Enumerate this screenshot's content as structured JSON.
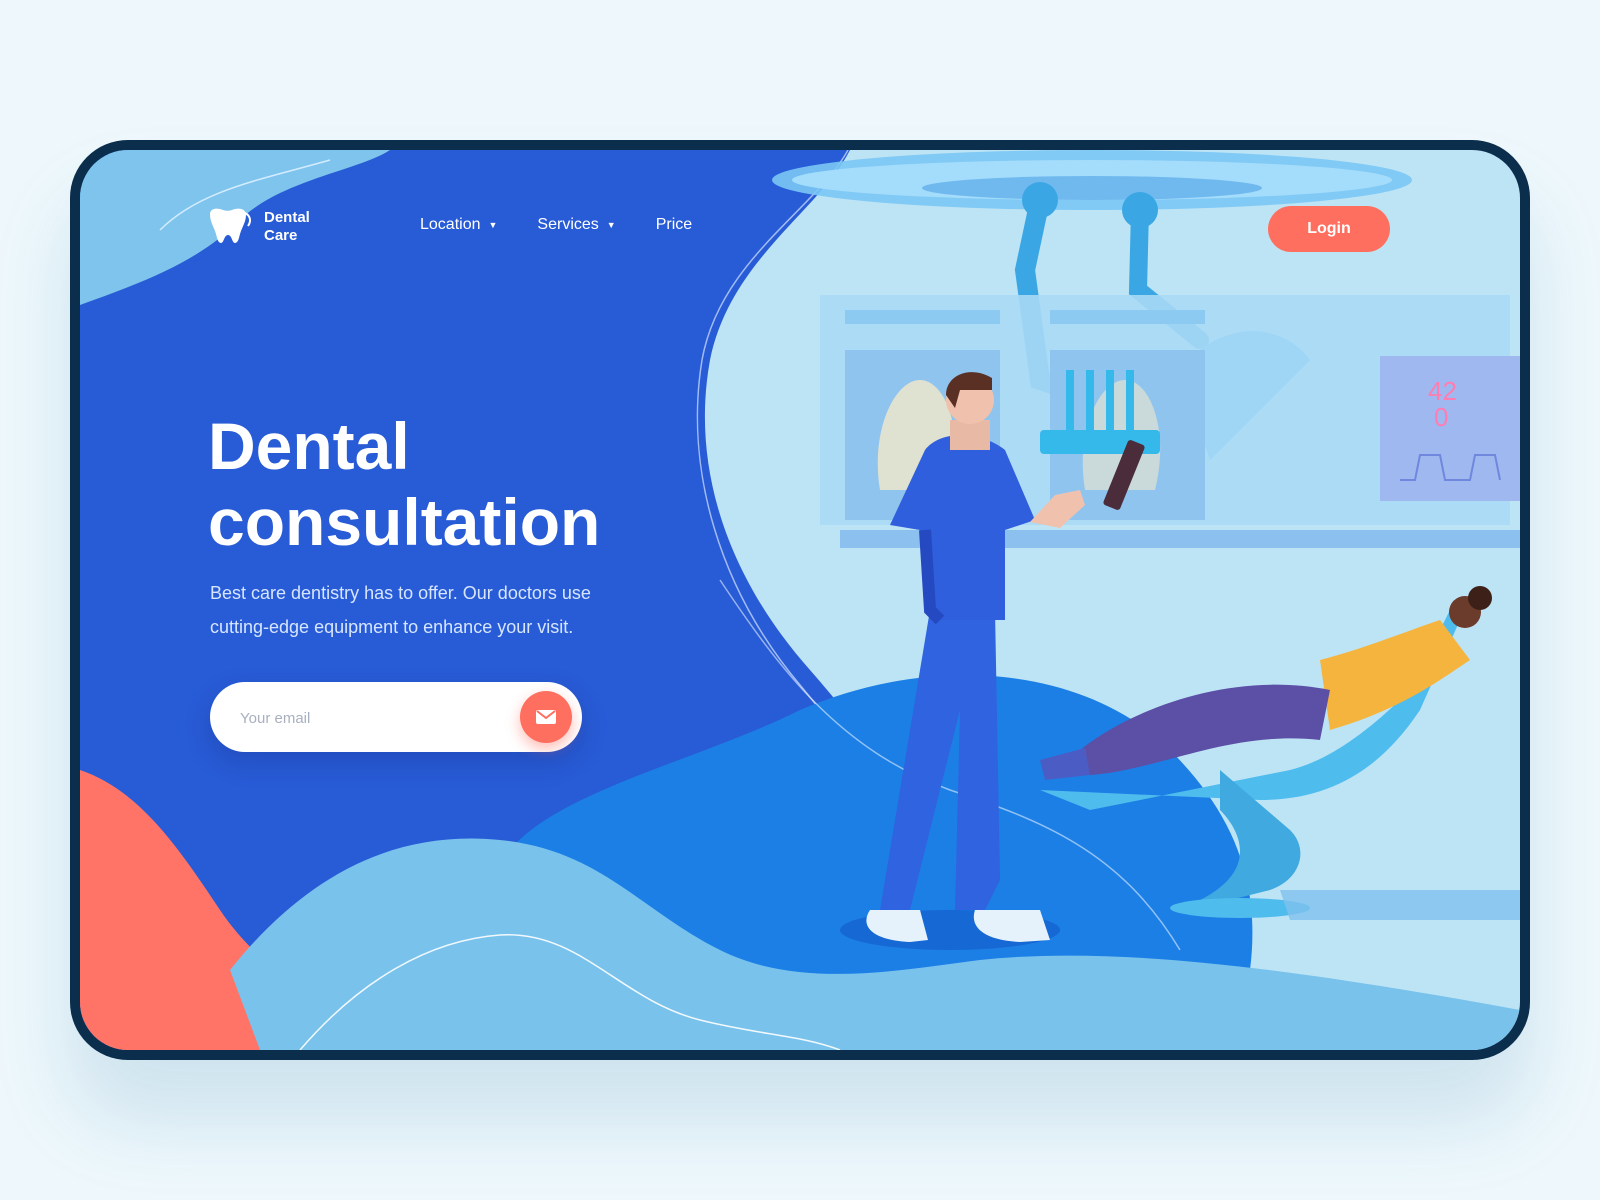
{
  "brand": {
    "line1": "Dental",
    "line2": "Care",
    "icon": "tooth-icon"
  },
  "nav": {
    "location_label": "Location",
    "services_label": "Services",
    "price_label": "Price"
  },
  "auth": {
    "login_label": "Login"
  },
  "hero": {
    "title_line1": "Dental",
    "title_line2": "consultation",
    "subtitle": "Best care dentistry has to offer. Our doctors use cutting-edge equipment to enhance your visit."
  },
  "signup": {
    "email_placeholder": "Your email",
    "submit_icon": "envelope-icon"
  },
  "monitor": {
    "reading_top": "42",
    "reading_bottom": "0"
  },
  "colors": {
    "primary_blue": "#285bd6",
    "accent_coral": "#ff6f5f",
    "light_blue": "#79c2ec",
    "frame": "#0b2e4c"
  }
}
